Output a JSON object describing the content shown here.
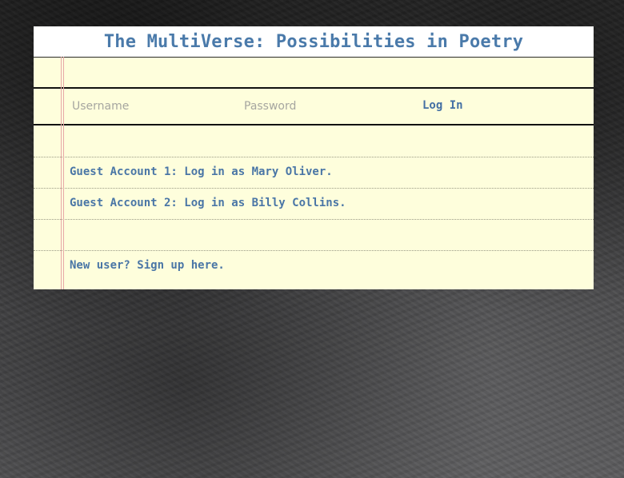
{
  "header": {
    "title": "The MultiVerse: Possibilities in Poetry"
  },
  "login": {
    "username_placeholder": "Username",
    "password_placeholder": "Password",
    "login_label": "Log In"
  },
  "guest_accounts": [
    {
      "label": "Guest Account 1: Log in as Mary Oliver."
    },
    {
      "label": "Guest Account 2: Log in as Billy Collins."
    }
  ],
  "signup": {
    "label": "New user? Sign up here."
  },
  "colors": {
    "paper": "#fefedc",
    "link": "#4a76a6",
    "margin_line": "#e7a7a7",
    "placeholder": "#a6a6a0"
  }
}
